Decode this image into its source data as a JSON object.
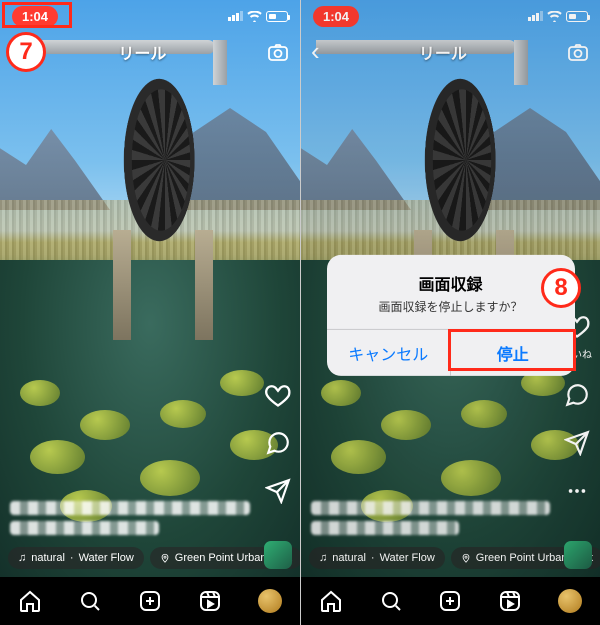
{
  "status": {
    "time": "1:04",
    "wifi": true
  },
  "nav": {
    "title": "リール"
  },
  "rail": {
    "like_label": "いいね"
  },
  "audio": {
    "note": "♫",
    "artist": "natural",
    "track": "Water Flow"
  },
  "location": {
    "name": "Green Point Urban Park"
  },
  "alert": {
    "title": "画面収録",
    "message": "画面収録を停止しますか？",
    "cancel": "キャンセル",
    "stop": "停止"
  },
  "annotations": {
    "step7": "7",
    "step8": "8"
  },
  "tabs": [
    "home",
    "search",
    "create",
    "reels",
    "profile"
  ]
}
